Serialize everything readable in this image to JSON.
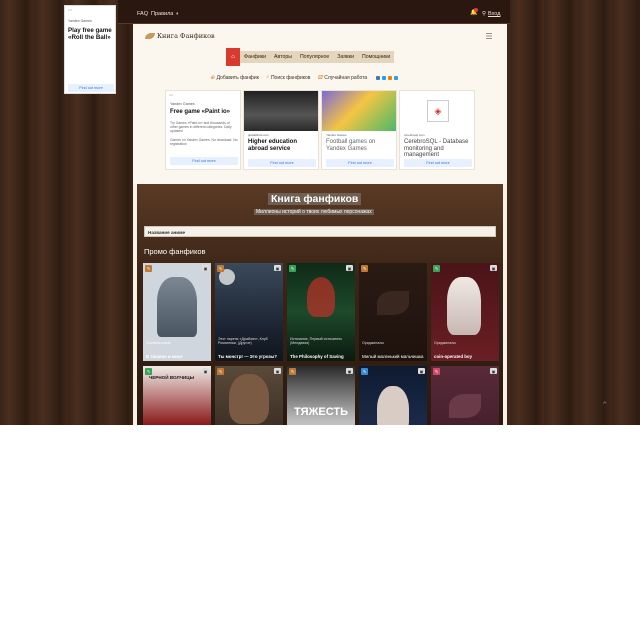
{
  "topbar": {
    "faq": "FAQ",
    "rules": "Правила",
    "login": "Вход"
  },
  "logo": {
    "text": "Книга Фанфиков"
  },
  "nav": {
    "items": [
      {
        "label": "Фанфики"
      },
      {
        "label": "Авторы"
      },
      {
        "label": "Популярное"
      },
      {
        "label": "Заявки"
      },
      {
        "label": "Помощники"
      }
    ]
  },
  "subnav": {
    "add": "Добавить фанфик",
    "search": "Поиск фанфиков",
    "random": "Случайная работа"
  },
  "side_ad": {
    "brand": "Yandex Games",
    "title": "Play free game «Roll the Ball»",
    "button": "Find out more"
  },
  "ads": [
    {
      "brand": "Yandex Games",
      "title": "Free game «Paint io»",
      "desc": "Try Games «Paint.io» and thousands of other games in different categories. Daily updates!",
      "desc2": "Games on Yandex Games. No download. No registration",
      "button": "Find out more"
    },
    {
      "source": "globalfinds.com",
      "title": "Higher education abroad service",
      "button": "Find out more"
    },
    {
      "source": "Yandex Games",
      "title": "Football games on Yandex Games",
      "button": "Find out more"
    },
    {
      "source": "cerebrosql.com",
      "title": "CerebroSQL - Database monitoring and management",
      "button": "Find out more"
    }
  ],
  "hero": {
    "title": "Книга фанфиков",
    "subtitle": "Миллионы историй о твоих любимых персонажах",
    "search_placeholder": "Название аниме"
  },
  "promo": {
    "title": "Промо фанфиков",
    "cards": [
      {
        "meta": "Оригинальные",
        "title": "В тишине и мисе",
        "badge_color": "#c07a35",
        "bg": "#cfd6de"
      },
      {
        "meta": "Этот парень «Драйзин», Клуб Романтики, (Другое)",
        "title": "Ты монстр! — Это угрозы?",
        "badge_color": "#c07a35",
        "bg": "#23303e"
      },
      {
        "meta": "Истязание, Первый истязатель (Мелдивия)",
        "title": "The Philosophy of Saving",
        "badge_color": "#3aa35a",
        "bg": "#1a3a26"
      },
      {
        "meta": "Ориджиналы",
        "title": "Милый маленький мальчишка",
        "badge_color": "#c07a35",
        "bg": "#2a1a14"
      },
      {
        "meta": "Ориджиналы",
        "title": "coin-operated boy",
        "badge_color": "#3aa35a",
        "bg": "#5a1a20"
      },
      {
        "title_img": "ЧЕРНОЙ ВОЛЧИЦЫ",
        "badge_color": "#3aa35a",
        "bg": "#3a1a1a"
      },
      {
        "badge_color": "#c07a35",
        "bg": "#4a3a2a"
      },
      {
        "title_img": "ТЯЖЕСТЬ",
        "badge_color": "#c07a35",
        "bg": "#6a6a6a"
      },
      {
        "badge_color": "#3a8ad0",
        "bg": "#1a2a4a"
      },
      {
        "badge_color": "#d04a6a",
        "bg": "#6a2a3a"
      }
    ]
  }
}
